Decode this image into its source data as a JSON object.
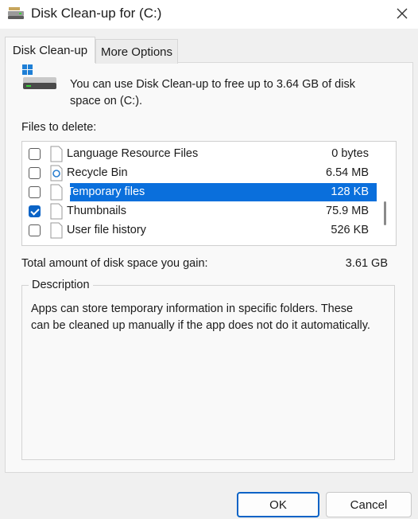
{
  "window": {
    "title": "Disk Clean-up for  (C:)",
    "icons": {
      "app": "disk-cleanup-icon",
      "close": "close-icon"
    }
  },
  "tabs": [
    {
      "label": "Disk Clean-up",
      "active": true
    },
    {
      "label": "More Options",
      "active": false
    }
  ],
  "intro": "You can use Disk Clean-up to free up to 3.64 GB of disk space on  (C:).",
  "files_label": "Files to delete:",
  "files": [
    {
      "name": "Language Resource Files",
      "size": "0 bytes",
      "checked": false,
      "selected": false,
      "icon": "file-icon"
    },
    {
      "name": "Recycle Bin",
      "size": "6.54 MB",
      "checked": false,
      "selected": false,
      "icon": "recycle-bin-icon"
    },
    {
      "name": "Temporary files",
      "size": "128 KB",
      "checked": false,
      "selected": true,
      "icon": "file-icon"
    },
    {
      "name": "Thumbnails",
      "size": "75.9 MB",
      "checked": true,
      "selected": false,
      "icon": "file-icon"
    },
    {
      "name": "User file history",
      "size": "526 KB",
      "checked": false,
      "selected": false,
      "icon": "file-icon"
    }
  ],
  "total": {
    "label": "Total amount of disk space you gain:",
    "value": "3.61 GB"
  },
  "description": {
    "title": "Description",
    "text": "Apps can store temporary information in specific folders. These can be cleaned up manually if the app does not do it automatically."
  },
  "buttons": {
    "ok": "OK",
    "cancel": "Cancel"
  },
  "colors": {
    "accent": "#0a63c6",
    "selection": "#0a6fdc"
  }
}
